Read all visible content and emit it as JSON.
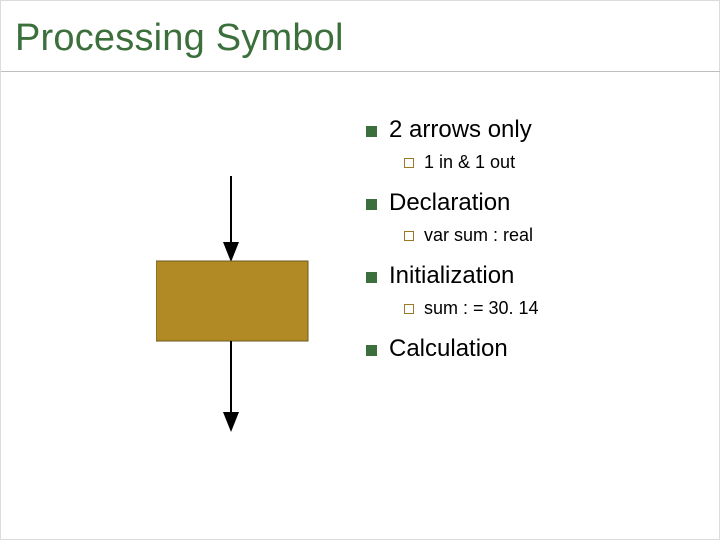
{
  "title": "Processing Symbol",
  "diagram": {
    "rect_fill": "#b18a26",
    "rect_stroke": "#6b5a1a",
    "arrow_color": "#000000"
  },
  "bullets": {
    "b1": {
      "label": "2 arrows only",
      "sub": "1 in & 1 out"
    },
    "b2": {
      "label": "Declaration",
      "sub": "var sum : real"
    },
    "b3": {
      "label": "Initialization",
      "sub": "sum : = 30. 14"
    },
    "b4": {
      "label": "Calculation"
    }
  }
}
